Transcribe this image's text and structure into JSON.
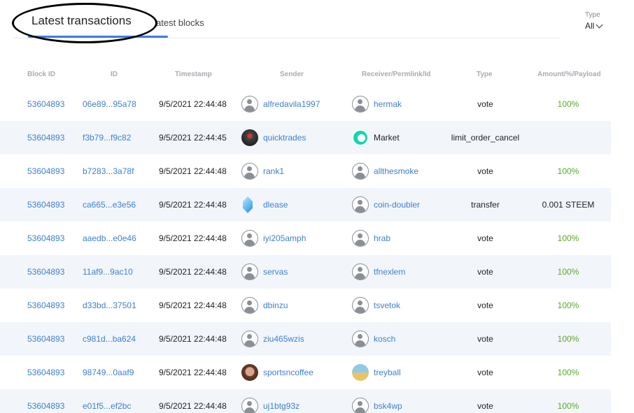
{
  "tabs": {
    "active": "Latest transactions",
    "inactive": "atest blocks"
  },
  "filter": {
    "label": "Type",
    "value": "All"
  },
  "columns": [
    "Block ID",
    "ID",
    "Timestamp",
    "Sender",
    "Receiver/Permlink/Id",
    "Type",
    "Amount/%/Payload"
  ],
  "rows": [
    {
      "block": "53604893",
      "id": "06e89...95a78",
      "ts": "9/5/2021 22:44:48",
      "sender": "alfredavila1997",
      "sender_icon": "default-avatar-icon",
      "receiver": "hermak",
      "receiver_icon": "default-avatar-icon",
      "receiver_link": true,
      "type": "vote",
      "amount": "100%",
      "amount_color": "green"
    },
    {
      "block": "53604893",
      "id": "f3b79...f9c82",
      "ts": "9/5/2021 22:44:45",
      "sender": "quicktrades",
      "sender_icon": "photo-avatar-icon",
      "receiver": "Market",
      "receiver_icon": "market-icon",
      "receiver_link": false,
      "type": "limit_order_cancel",
      "amount": "",
      "amount_color": "plain"
    },
    {
      "block": "53604893",
      "id": "b7283...3a78f",
      "ts": "9/5/2021 22:44:48",
      "sender": "rank1",
      "sender_icon": "default-avatar-icon",
      "receiver": "allthesmoke",
      "receiver_icon": "default-avatar-icon",
      "receiver_link": true,
      "type": "vote",
      "amount": "100%",
      "amount_color": "green"
    },
    {
      "block": "53604893",
      "id": "ca665...e3e56",
      "ts": "9/5/2021 22:44:48",
      "sender": "dlease",
      "sender_icon": "crystal-icon",
      "receiver": "coin-doubler",
      "receiver_icon": "default-avatar-icon",
      "receiver_link": true,
      "type": "transfer",
      "amount": "0.001 STEEM",
      "amount_color": "plain"
    },
    {
      "block": "53604893",
      "id": "aaedb...e0e46",
      "ts": "9/5/2021 22:44:48",
      "sender": "iyi205amph",
      "sender_icon": "default-avatar-icon",
      "receiver": "hrab",
      "receiver_icon": "default-avatar-icon",
      "receiver_link": true,
      "type": "vote",
      "amount": "100%",
      "amount_color": "green"
    },
    {
      "block": "53604893",
      "id": "11af9...9ac10",
      "ts": "9/5/2021 22:44:48",
      "sender": "servas",
      "sender_icon": "default-avatar-icon",
      "receiver": "tfnexlem",
      "receiver_icon": "default-avatar-icon",
      "receiver_link": true,
      "type": "vote",
      "amount": "100%",
      "amount_color": "green"
    },
    {
      "block": "53604893",
      "id": "d33bd...37501",
      "ts": "9/5/2021 22:44:48",
      "sender": "dbinzu",
      "sender_icon": "default-avatar-icon",
      "receiver": "tsvetok",
      "receiver_icon": "default-avatar-icon",
      "receiver_link": true,
      "type": "vote",
      "amount": "100%",
      "amount_color": "green"
    },
    {
      "block": "53604893",
      "id": "c981d...ba624",
      "ts": "9/5/2021 22:44:48",
      "sender": "ziu465wzis",
      "sender_icon": "default-avatar-icon",
      "receiver": "kosch",
      "receiver_icon": "default-avatar-icon",
      "receiver_link": true,
      "type": "vote",
      "amount": "100%",
      "amount_color": "green"
    },
    {
      "block": "53604893",
      "id": "98749...0aaf9",
      "ts": "9/5/2021 22:44:48",
      "sender": "sportsncoffee",
      "sender_icon": "photo-avatar-icon",
      "receiver": "treyball",
      "receiver_icon": "photo-avatar-icon",
      "receiver_link": true,
      "type": "vote",
      "amount": "100%",
      "amount_color": "green"
    },
    {
      "block": "53604893",
      "id": "e01f5...ef2bc",
      "ts": "9/5/2021 22:44:48",
      "sender": "uj1btg93z",
      "sender_icon": "default-avatar-icon",
      "receiver": "bsk4wp",
      "receiver_icon": "default-avatar-icon",
      "receiver_link": true,
      "type": "vote",
      "amount": "100%",
      "amount_color": "green"
    }
  ]
}
